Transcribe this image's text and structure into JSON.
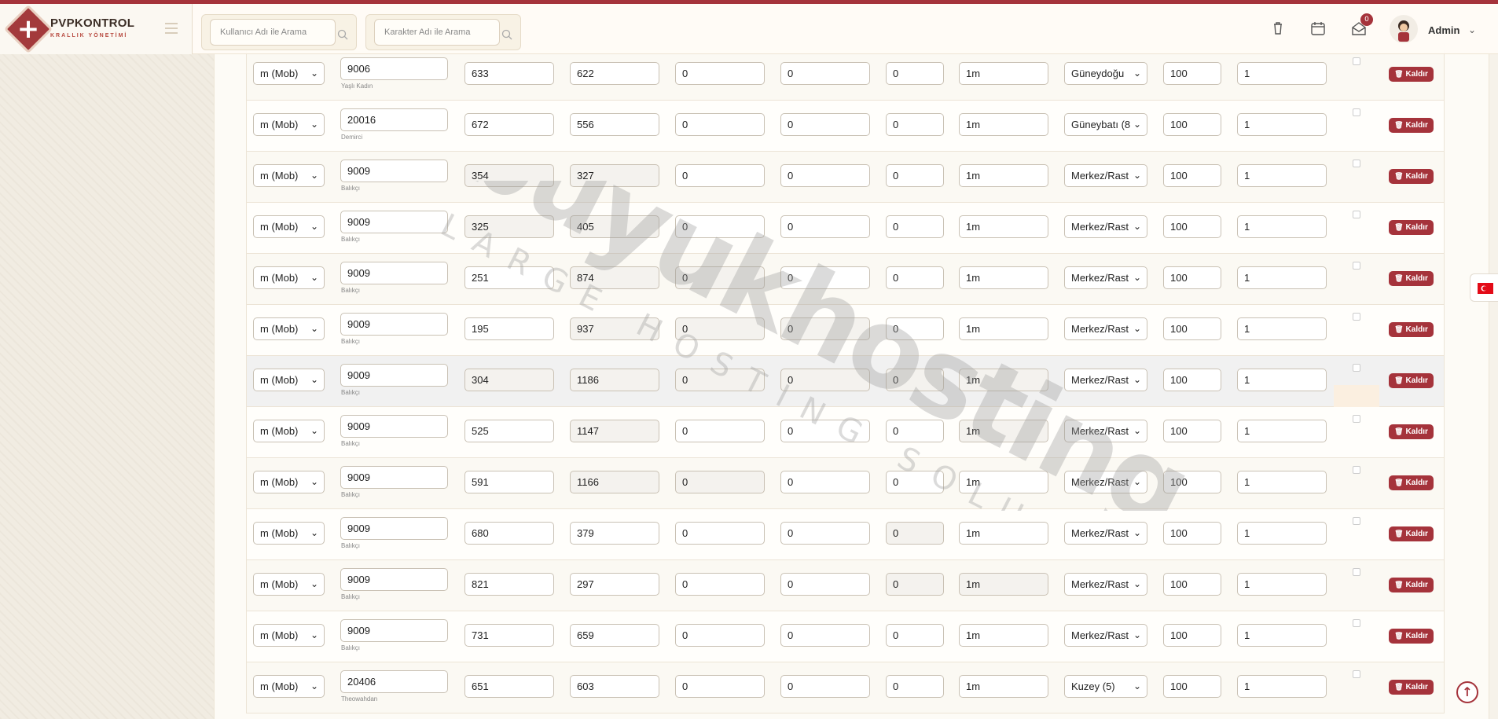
{
  "brand": {
    "title": "PVPKONTROL",
    "subtitle": "KRALLIK YÖNETİMİ"
  },
  "header": {
    "search_user_placeholder": "Kullanıcı Adı ile Arama",
    "search_char_placeholder": "Karakter Adı ile Arama",
    "notification_count": "0",
    "user_name": "Admin"
  },
  "icons": [
    "trash-icon",
    "calendar-icon",
    "mail-icon",
    "chevron-down-icon",
    "search-icon",
    "arrow-up-icon",
    "flag-tr-icon"
  ],
  "colors": {
    "accent": "#a5333b",
    "background": "#f6f2ea"
  },
  "watermark": {
    "line1": "buyukhosting",
    "line2": "LARGE HOSTING SOLUTIONS"
  },
  "remove_label": "Kaldır",
  "rows": [
    {
      "type": "m (Mob)",
      "id": "9006",
      "name": "Yaşlı Kadın",
      "x": "633",
      "y": "622",
      "a": "0",
      "b": "0",
      "c": "0",
      "time": "1m",
      "dir": "Güneydoğu",
      "count": "100",
      "n": "1"
    },
    {
      "type": "m (Mob)",
      "id": "20016",
      "name": "Demirci",
      "x": "672",
      "y": "556",
      "a": "0",
      "b": "0",
      "c": "0",
      "time": "1m",
      "dir": "Güneybatı (8",
      "count": "100",
      "n": "1"
    },
    {
      "type": "m (Mob)",
      "id": "9009",
      "name": "Balıkçı",
      "x": "354",
      "y": "327",
      "a": "0",
      "b": "0",
      "c": "0",
      "time": "1m",
      "dir": "Merkez/Rast",
      "count": "100",
      "n": "1"
    },
    {
      "type": "m (Mob)",
      "id": "9009",
      "name": "Balıkçı",
      "x": "325",
      "y": "405",
      "a": "0",
      "b": "0",
      "c": "0",
      "time": "1m",
      "dir": "Merkez/Rast",
      "count": "100",
      "n": "1"
    },
    {
      "type": "m (Mob)",
      "id": "9009",
      "name": "Balıkçı",
      "x": "251",
      "y": "874",
      "a": "0",
      "b": "0",
      "c": "0",
      "time": "1m",
      "dir": "Merkez/Rast",
      "count": "100",
      "n": "1"
    },
    {
      "type": "m (Mob)",
      "id": "9009",
      "name": "Balıkçı",
      "x": "195",
      "y": "937",
      "a": "0",
      "b": "0",
      "c": "0",
      "time": "1m",
      "dir": "Merkez/Rast",
      "count": "100",
      "n": "1"
    },
    {
      "type": "m (Mob)",
      "id": "9009",
      "name": "Balıkçı",
      "x": "304",
      "y": "1186",
      "a": "0",
      "b": "0",
      "c": "0",
      "time": "1m",
      "dir": "Merkez/Rast",
      "count": "100",
      "n": "1"
    },
    {
      "type": "m (Mob)",
      "id": "9009",
      "name": "Balıkçı",
      "x": "525",
      "y": "1147",
      "a": "0",
      "b": "0",
      "c": "0",
      "time": "1m",
      "dir": "Merkez/Rast",
      "count": "100",
      "n": "1"
    },
    {
      "type": "m (Mob)",
      "id": "9009",
      "name": "Balıkçı",
      "x": "591",
      "y": "1166",
      "a": "0",
      "b": "0",
      "c": "0",
      "time": "1m",
      "dir": "Merkez/Rast",
      "count": "100",
      "n": "1"
    },
    {
      "type": "m (Mob)",
      "id": "9009",
      "name": "Balıkçı",
      "x": "680",
      "y": "379",
      "a": "0",
      "b": "0",
      "c": "0",
      "time": "1m",
      "dir": "Merkez/Rast",
      "count": "100",
      "n": "1"
    },
    {
      "type": "m (Mob)",
      "id": "9009",
      "name": "Balıkçı",
      "x": "821",
      "y": "297",
      "a": "0",
      "b": "0",
      "c": "0",
      "time": "1m",
      "dir": "Merkez/Rast",
      "count": "100",
      "n": "1"
    },
    {
      "type": "m (Mob)",
      "id": "9009",
      "name": "Balıkçı",
      "x": "731",
      "y": "659",
      "a": "0",
      "b": "0",
      "c": "0",
      "time": "1m",
      "dir": "Merkez/Rast",
      "count": "100",
      "n": "1"
    },
    {
      "type": "m (Mob)",
      "id": "20406",
      "name": "Theowahdan",
      "x": "651",
      "y": "603",
      "a": "0",
      "b": "0",
      "c": "0",
      "time": "1m",
      "dir": "Kuzey (5)",
      "count": "100",
      "n": "1"
    }
  ]
}
